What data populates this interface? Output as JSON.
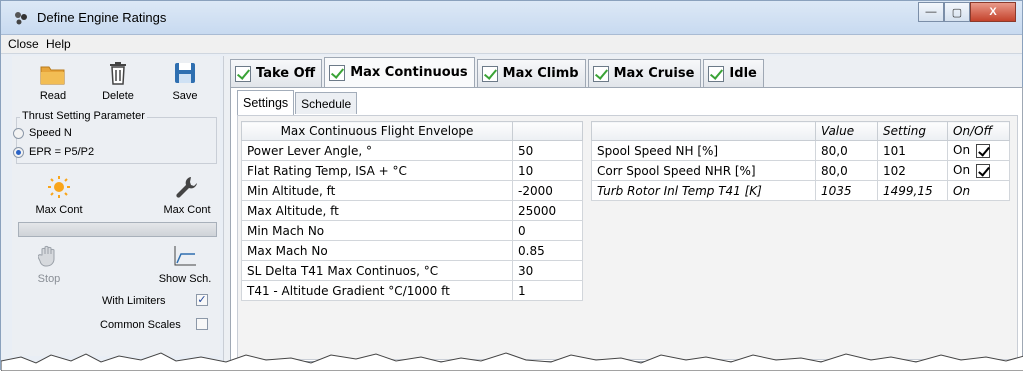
{
  "window": {
    "title": "Define Engine Ratings",
    "controls": {
      "minimize": "—",
      "maximize": "▢",
      "close": "X"
    }
  },
  "menu": {
    "items": [
      "Close",
      "Help"
    ]
  },
  "toolbar": {
    "read_label": "Read",
    "delete_label": "Delete",
    "save_label": "Save"
  },
  "thrust_setting": {
    "title": "Thrust Setting Parameter",
    "options": [
      "Speed N",
      "EPR = P5/P2"
    ],
    "selected": "EPR = P5/P2"
  },
  "actions": {
    "maxcont_run_label": "Max Cont",
    "maxcont_tool_label": "Max Cont",
    "stop_label": "Stop",
    "show_schedule_label": "Show Sch."
  },
  "options": {
    "with_limiters": {
      "label": "With Limiters",
      "checked": true
    },
    "common_scales": {
      "label": "Common Scales",
      "checked": false
    }
  },
  "rating_tabs": [
    "Take Off",
    "Max Continuous",
    "Max Climb",
    "Max Cruise",
    "Idle"
  ],
  "active_rating_tab": "Max Continuous",
  "sub_tabs": [
    "Settings",
    "Schedule"
  ],
  "active_sub_tab": "Settings",
  "envelope": {
    "header": "Max Continuous Flight Envelope",
    "rows": [
      {
        "label": "Power Lever Angle, °",
        "value": "50"
      },
      {
        "label": "Flat Rating Temp, ISA + °C",
        "value": "10"
      },
      {
        "label": "Min Altitude, ft",
        "value": "-2000"
      },
      {
        "label": "Max Altitude, ft",
        "value": "25000"
      },
      {
        "label": "Min Mach No",
        "value": "0"
      },
      {
        "label": "Max Mach No",
        "value": "0.85"
      },
      {
        "label": "SL Delta T41 Max Continuos, °C",
        "value": "30"
      },
      {
        "label": "T41 - Altitude Gradient °C/1000 ft",
        "value": "1"
      }
    ]
  },
  "limiters": {
    "headers": [
      "",
      "Value",
      "Setting",
      "On/Off"
    ],
    "rows": [
      {
        "name": "Spool Speed NH [%]",
        "value": "80,0",
        "setting": "101",
        "state": "On",
        "checked": true
      },
      {
        "name": "Corr Spool Speed NHR [%]",
        "value": "80,0",
        "setting": "102",
        "state": "On",
        "checked": true
      },
      {
        "name": "Turb Rotor Inl Temp T41 [K]",
        "value": "1035",
        "setting": "1499,15",
        "state": "On",
        "checked": false
      }
    ]
  },
  "colors": {
    "accent_green": "#3aa336",
    "titlebar": "#c8daf0",
    "panel": "#eceff3"
  }
}
